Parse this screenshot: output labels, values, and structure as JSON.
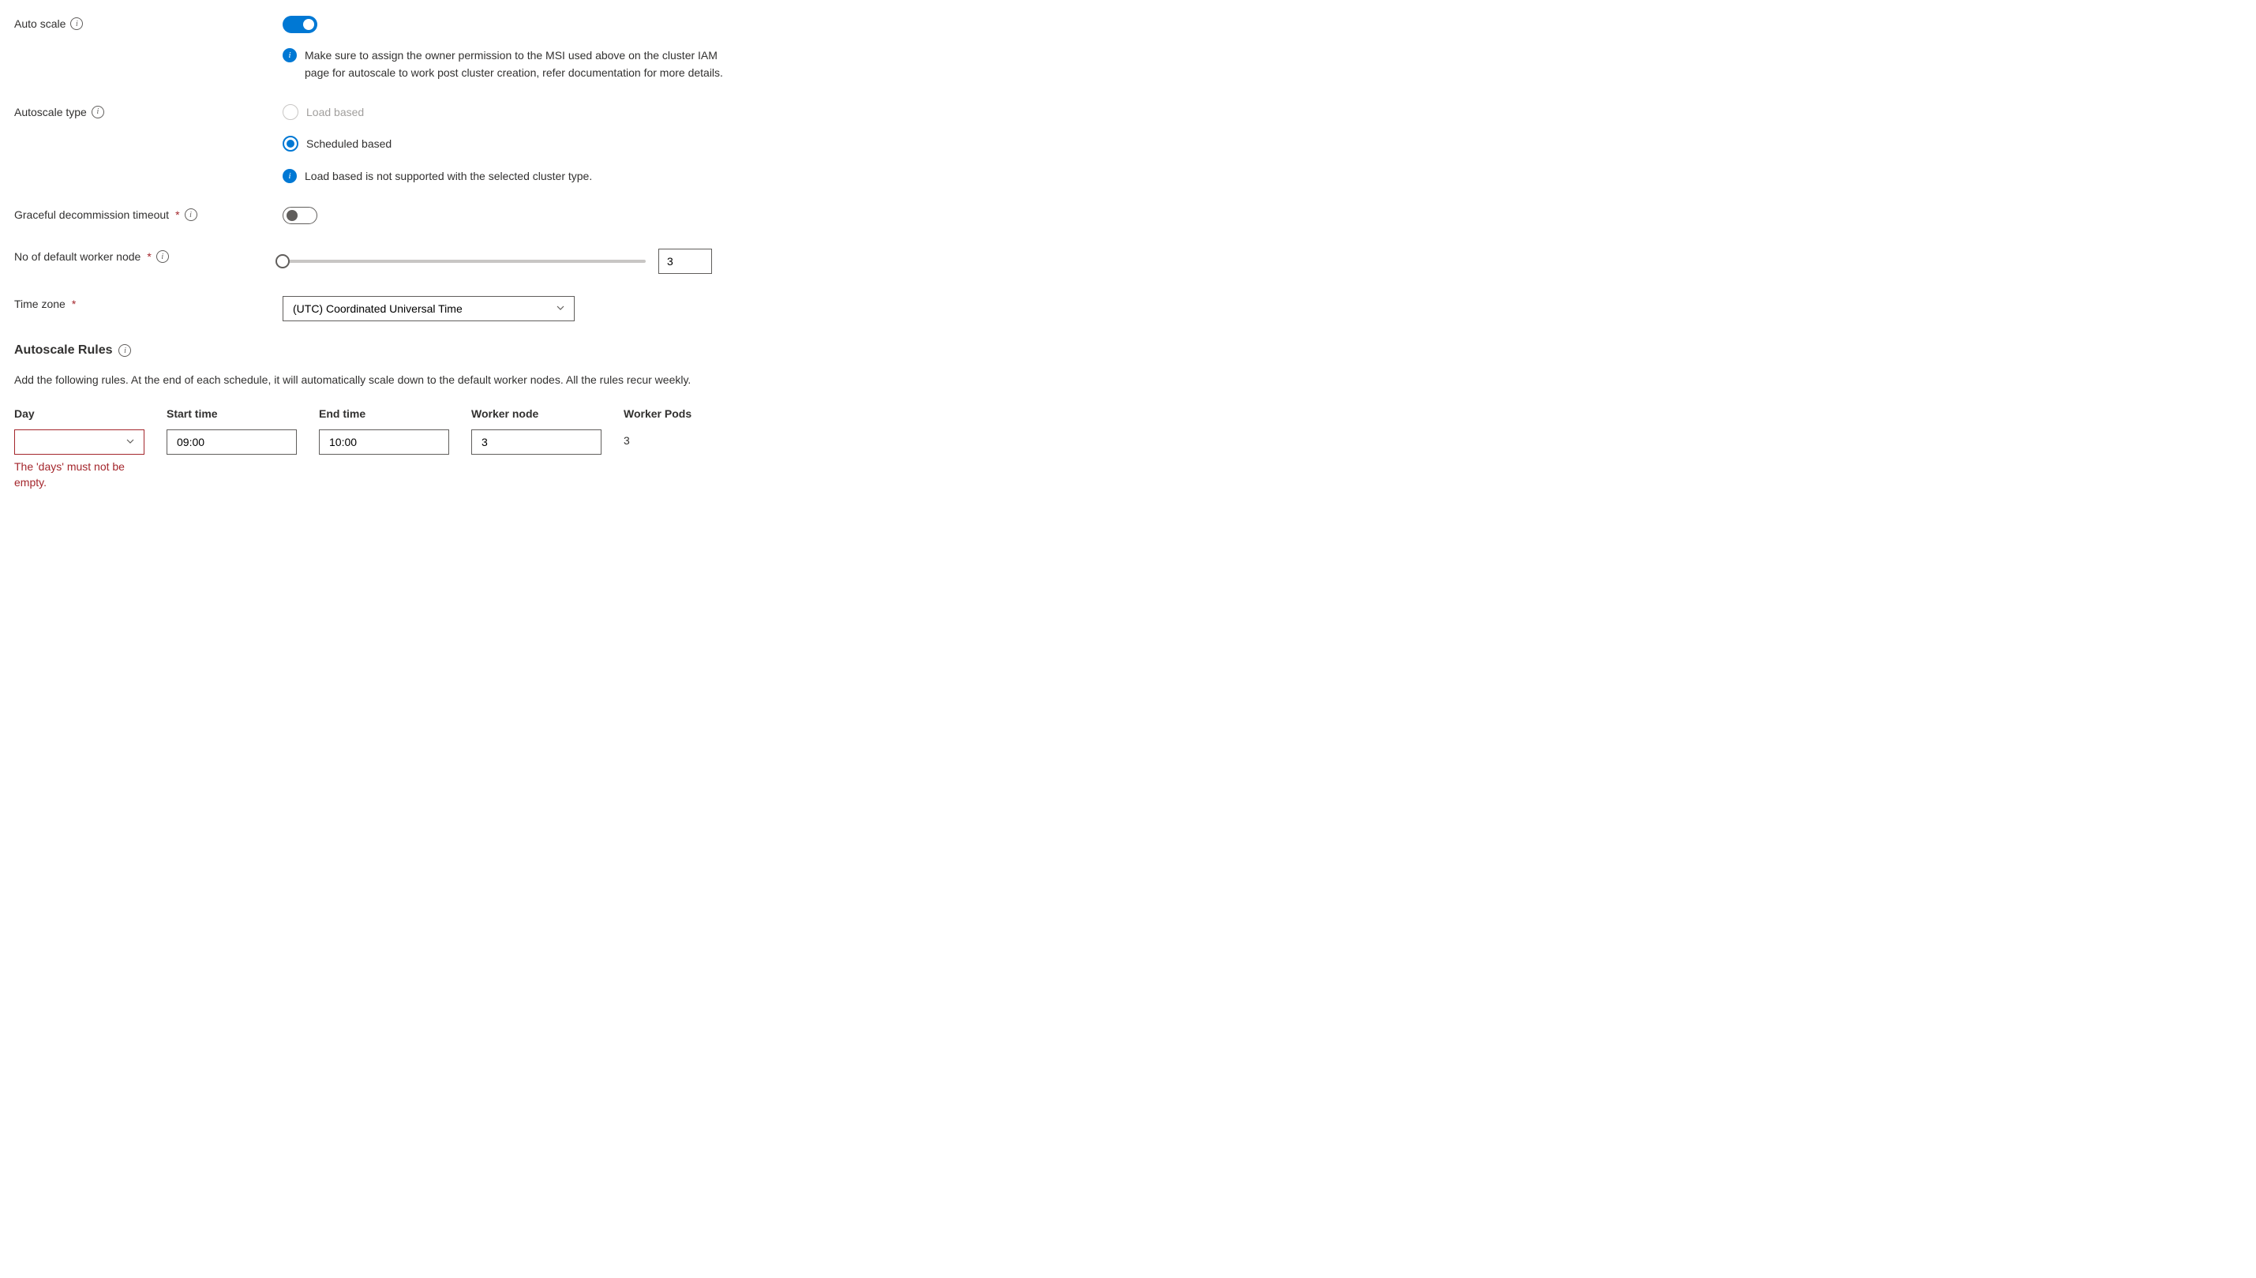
{
  "autoScale": {
    "label": "Auto scale",
    "infoNote": "Make sure to assign the owner permission to the MSI used above on the cluster IAM page for autoscale to work post cluster creation, refer documentation for more details."
  },
  "autoscaleType": {
    "label": "Autoscale type",
    "options": {
      "load": "Load based",
      "scheduled": "Scheduled based"
    },
    "warning": "Load based is not supported with the selected cluster type."
  },
  "gracefulDecommission": {
    "label": "Graceful decommission timeout"
  },
  "workerNode": {
    "label": "No of default worker node",
    "value": "3"
  },
  "timeZone": {
    "label": "Time zone",
    "value": "(UTC) Coordinated Universal Time"
  },
  "rulesSection": {
    "heading": "Autoscale Rules",
    "description": "Add the following rules. At the end of each schedule, it will automatically scale down to the default worker nodes. All the rules recur weekly."
  },
  "rulesTable": {
    "headers": {
      "day": "Day",
      "start": "Start time",
      "end": "End time",
      "worker": "Worker node",
      "pods": "Worker Pods"
    },
    "row": {
      "day": "",
      "start": "09:00",
      "end": "10:00",
      "worker": "3",
      "pods": "3"
    },
    "error": "The 'days' must not be empty."
  }
}
